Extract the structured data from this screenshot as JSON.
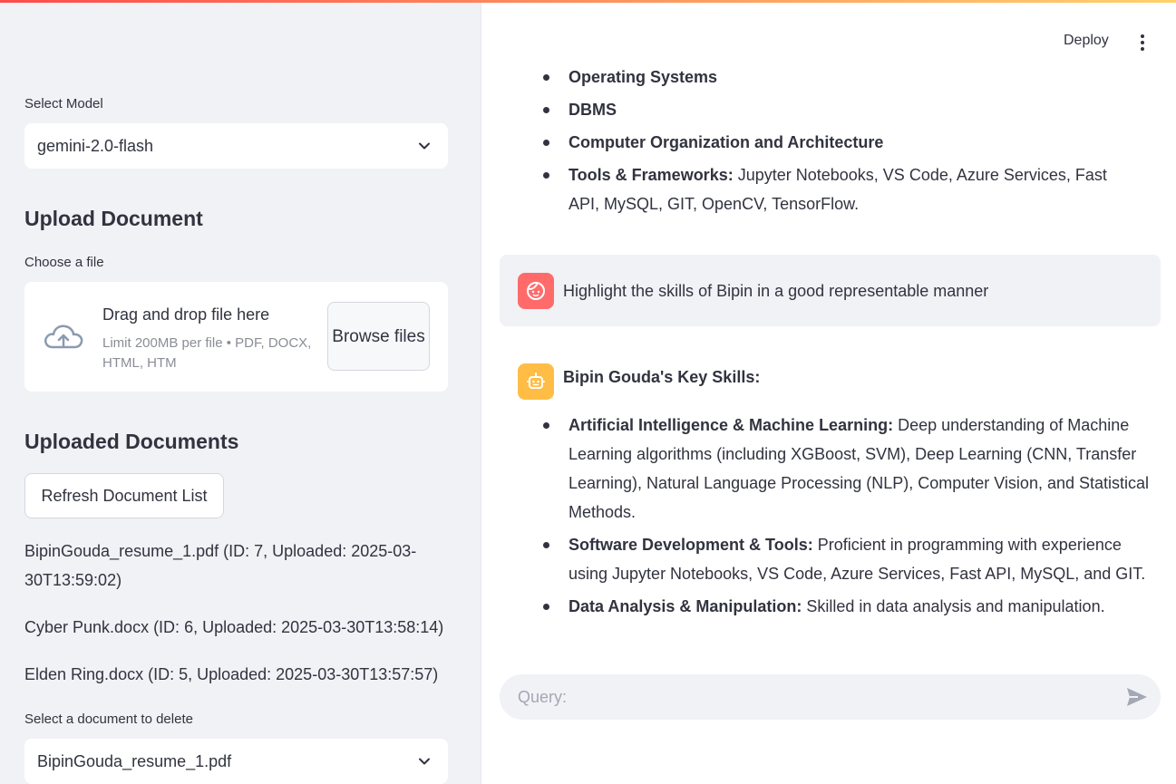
{
  "sidebar": {
    "model_label": "Select Model",
    "model_value": "gemini-2.0-flash",
    "upload_heading": "Upload Document",
    "file_label": "Choose a file",
    "dropzone_title": "Drag and drop file here",
    "dropzone_subtitle": "Limit 200MB per file • PDF, DOCX, HTML, HTM",
    "browse_label": "Browse files",
    "uploaded_heading": "Uploaded Documents",
    "refresh_label": "Refresh Document List",
    "documents": [
      "BipinGouda_resume_1.pdf (ID: 7, Uploaded: 2025-03-30T13:59:02)",
      "Cyber Punk.docx (ID: 6, Uploaded: 2025-03-30T13:58:14)",
      "Elden Ring.docx (ID: 5, Uploaded: 2025-03-30T13:57:57)"
    ],
    "delete_label": "Select a document to delete",
    "delete_value": "BipinGouda_resume_1.pdf"
  },
  "header": {
    "deploy_label": "Deploy"
  },
  "chat": {
    "prev_items": [
      {
        "bold": "Operating Systems",
        "text": ""
      },
      {
        "bold": "DBMS",
        "text": ""
      },
      {
        "bold": "Computer Organization and Architecture",
        "text": ""
      },
      {
        "bold": "Tools & Frameworks:",
        "text": " Jupyter Notebooks, VS Code, Azure Services, Fast API, MySQL, GIT, OpenCV, TensorFlow."
      }
    ],
    "user_message": "Highlight the skills of Bipin in a good representable manner",
    "bot_heading": "Bipin Gouda's Key Skills:",
    "bot_items": [
      {
        "bold": "Artificial Intelligence & Machine Learning:",
        "text": " Deep understanding of Machine Learning algorithms (including XGBoost, SVM), Deep Learning (CNN, Transfer Learning), Natural Language Processing (NLP), Computer Vision, and Statistical Methods."
      },
      {
        "bold": "Software Development & Tools:",
        "text": " Proficient in programming with experience using Jupyter Notebooks, VS Code, Azure Services, Fast API, MySQL, and GIT."
      },
      {
        "bold": "Data Analysis & Manipulation:",
        "text": " Skilled in data analysis and manipulation."
      }
    ],
    "query_placeholder": "Query:"
  },
  "colors": {
    "sidebar_bg": "#f0f2f6",
    "user_avatar": "#ff6b6b",
    "bot_avatar": "#ffbd45",
    "accent_gradient_start": "#ff4b4b",
    "accent_gradient_end": "#ffd16a"
  },
  "icons": [
    "cloud-upload-icon",
    "chevron-down-icon",
    "kebab-menu-icon",
    "user-avatar-icon",
    "bot-avatar-icon",
    "send-icon"
  ]
}
